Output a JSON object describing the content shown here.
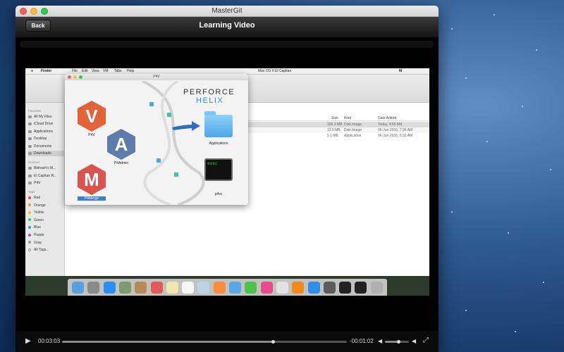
{
  "window": {
    "title": "MasterGit"
  },
  "navbar": {
    "back_label": "Back",
    "title": "Learning Video"
  },
  "video": {
    "menubar": {
      "app": "Finder",
      "items": [
        "File",
        "Edit",
        "View",
        "VM",
        "Tabs",
        "Help"
      ],
      "tab_label": "Mac OS X El Capitan",
      "status_letter": "M"
    },
    "sidebar": {
      "favorites_header": "Favorites",
      "favorites": [
        "All My Files",
        "iCloud Drive",
        "Applications",
        "Desktop",
        "Documents",
        "Downloads"
      ],
      "devices_header": "Devices",
      "devices": [
        "Bibhash's M...",
        "El Capitan R...",
        "P4V"
      ],
      "tags_header": "Tags",
      "tags": [
        {
          "name": "Red",
          "color": "#e74c3c"
        },
        {
          "name": "Orange",
          "color": "#f39c12"
        },
        {
          "name": "Yellow",
          "color": "#f1c40f"
        },
        {
          "name": "Green",
          "color": "#2ecc71"
        },
        {
          "name": "Blue",
          "color": "#3498db"
        },
        {
          "name": "Purple",
          "color": "#9b59b6"
        },
        {
          "name": "Gray",
          "color": "#95a5a6"
        },
        {
          "name": "All Tags...",
          "color": ""
        }
      ]
    },
    "list": {
      "headers": {
        "size": "Size",
        "kind": "Kind",
        "date": "Date Added"
      },
      "rows": [
        {
          "size": "106.3 MB",
          "kind": "Disk Image",
          "date": "Today, 4:55 AM"
        },
        {
          "size": "12.5 MB",
          "kind": "Disk Image",
          "date": "06-Jun-2016, 7:36 AM"
        },
        {
          "size": "5.1 MB",
          "kind": "Application",
          "date": "06-Jun-2016, 5:33 AM"
        }
      ]
    },
    "dmg": {
      "title": "P4V",
      "brand_line1": "PERFORCE",
      "brand_line2": "HELIX",
      "apps": [
        {
          "label": "P4V",
          "letter": "V",
          "color": "#e0633a"
        },
        {
          "label": "P4Admin",
          "letter": "A",
          "color": "#5d7bab"
        },
        {
          "label": "P4Merge",
          "letter": "M",
          "color": "#d9534f"
        }
      ],
      "applications_label": "Applications",
      "p4vc_label": "p4vc",
      "term_text": "exec"
    }
  },
  "controls": {
    "elapsed": "00:03:03",
    "remaining": "-00:01:02",
    "progress_fraction": 0.74,
    "volume_fraction": 0.55
  },
  "colors": {
    "accent": "#2d8ec9"
  }
}
